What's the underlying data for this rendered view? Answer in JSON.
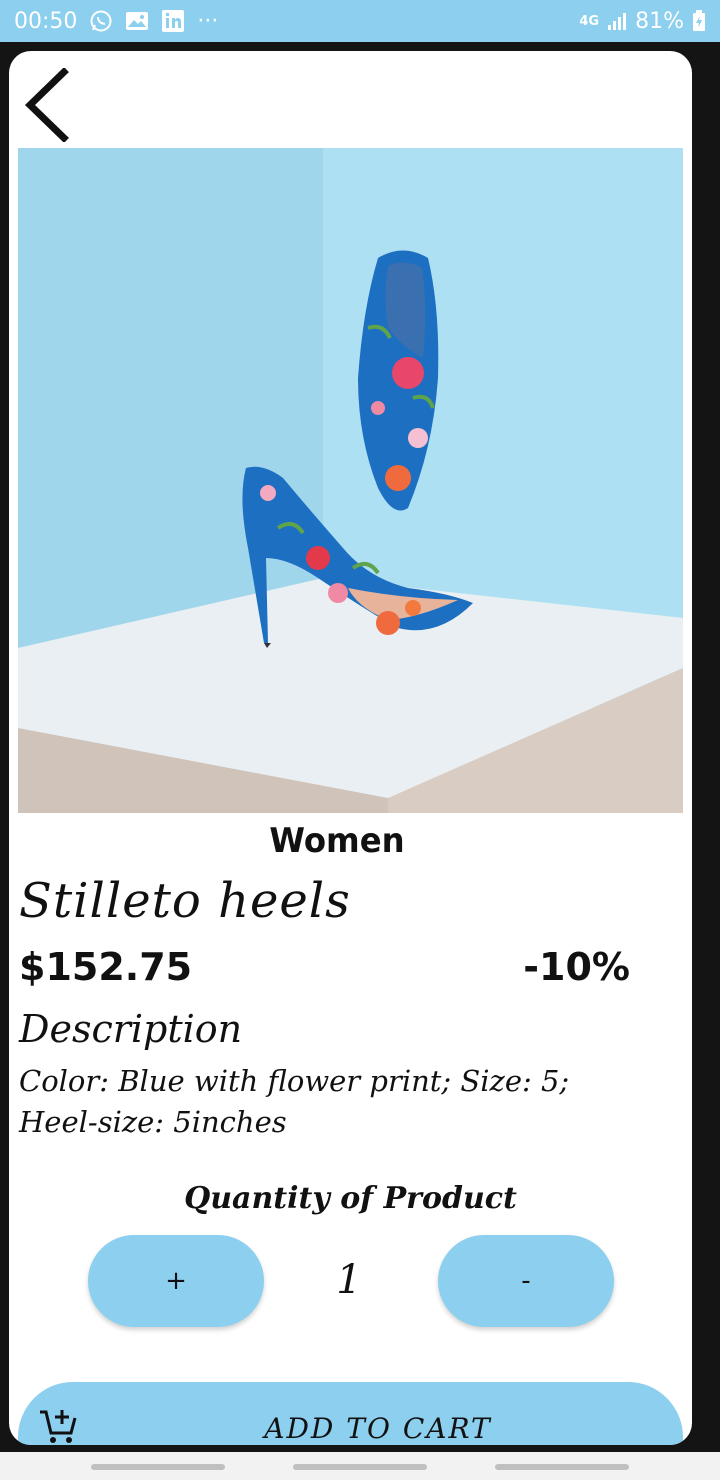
{
  "status_bar": {
    "time": "00:50",
    "more": "···",
    "network": "4G",
    "battery": "81%",
    "icons": [
      "whatsapp-icon",
      "gallery-icon",
      "linkedin-icon",
      "signal-icon",
      "battery-charging-icon"
    ]
  },
  "colors": {
    "accent": "#8ccfee",
    "card_bg": "#ffffff",
    "page_bg": "#141414",
    "text": "#111111"
  },
  "product": {
    "category": "Women",
    "name": "Stilleto heels",
    "price": "$152.75",
    "discount": "-10%",
    "description_heading": "Description",
    "description_line1": "Color: Blue with flower print; Size: 5;",
    "description_line2": "Heel-size: 5inches",
    "image_subject": "blue floral stiletto heels"
  },
  "quantity": {
    "label": "Quantity of Product",
    "increment": "+",
    "decrement": "-",
    "value": "1"
  },
  "cart": {
    "label": "ADD TO CART",
    "icon": "add-to-cart-icon"
  },
  "navigation": {
    "back_icon": "chevron-left-icon"
  }
}
